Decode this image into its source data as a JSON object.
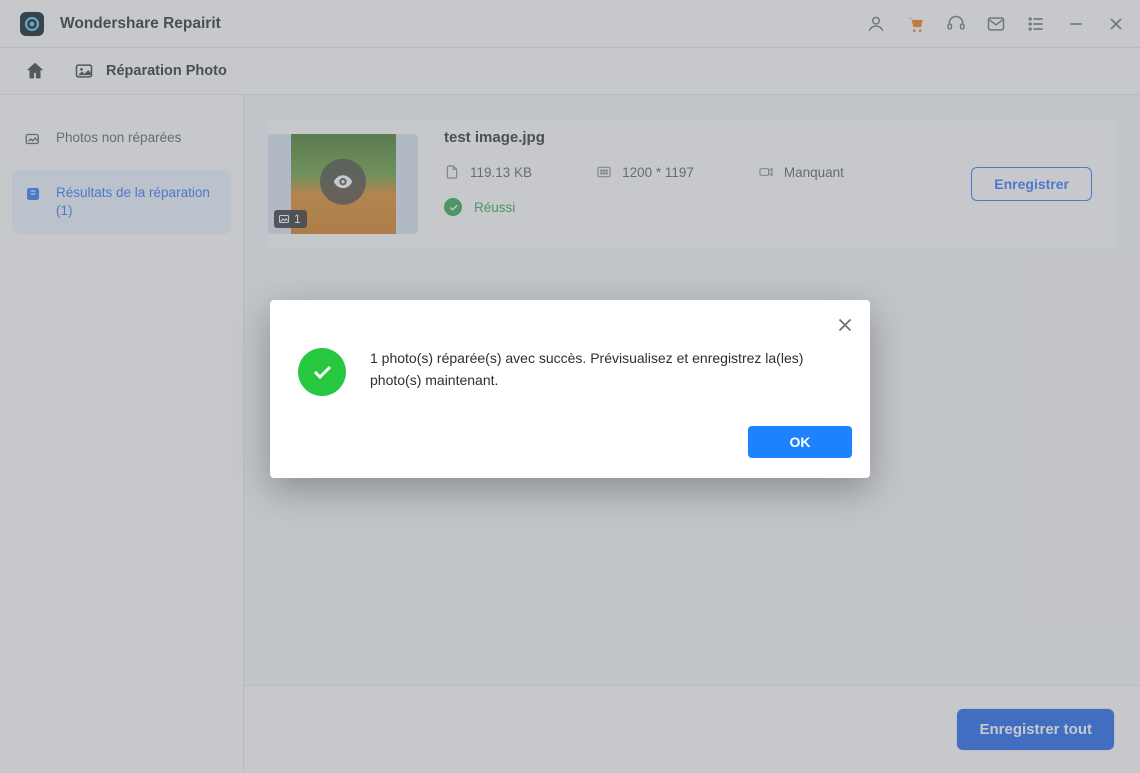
{
  "app": {
    "title": "Wondershare Repairit"
  },
  "breadcrumb": {
    "section": "Réparation Photo"
  },
  "sidebar": {
    "items": [
      {
        "label": "Photos non réparées"
      },
      {
        "label": "Résultats de la réparation (1)"
      }
    ]
  },
  "file": {
    "name": "test image.jpg",
    "size": "119.13  KB",
    "dimensions": "1200 * 1197",
    "camera": "Manquant",
    "status": "Réussi",
    "badge_count": "1",
    "save_label": "Enregistrer"
  },
  "footer": {
    "save_all": "Enregistrer tout"
  },
  "modal": {
    "message": "1 photo(s) réparée(s) avec succès. Prévisualisez et enregistrez la(les) photo(s) maintenant.",
    "ok": "OK"
  }
}
